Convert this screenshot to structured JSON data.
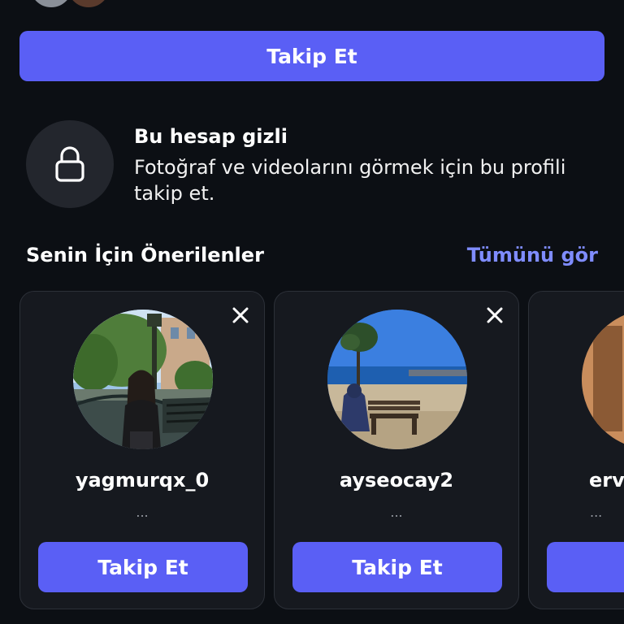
{
  "header": {
    "follow_label": "Takip Et"
  },
  "private_notice": {
    "title": "Bu hesap gizli",
    "description": "Fotoğraf ve videolarını görmek için bu profili takip et."
  },
  "suggestions": {
    "title": "Senin İçin Önerilenler",
    "see_all": "Tümünü gör",
    "cards": [
      {
        "username": "yagmurqx_0",
        "subtitle": "...",
        "follow_label": "Takip Et"
      },
      {
        "username": "ayseocay2",
        "subtitle": "...",
        "follow_label": "Takip Et"
      },
      {
        "username": "erv",
        "subtitle": "...",
        "follow_label": "Ta"
      }
    ]
  },
  "colors": {
    "background": "#0c0f14",
    "accent": "#5a5ff5",
    "link": "#7f8cff",
    "card": "#16191f"
  },
  "icons": {
    "lock": "lock-icon",
    "close": "close-icon"
  }
}
